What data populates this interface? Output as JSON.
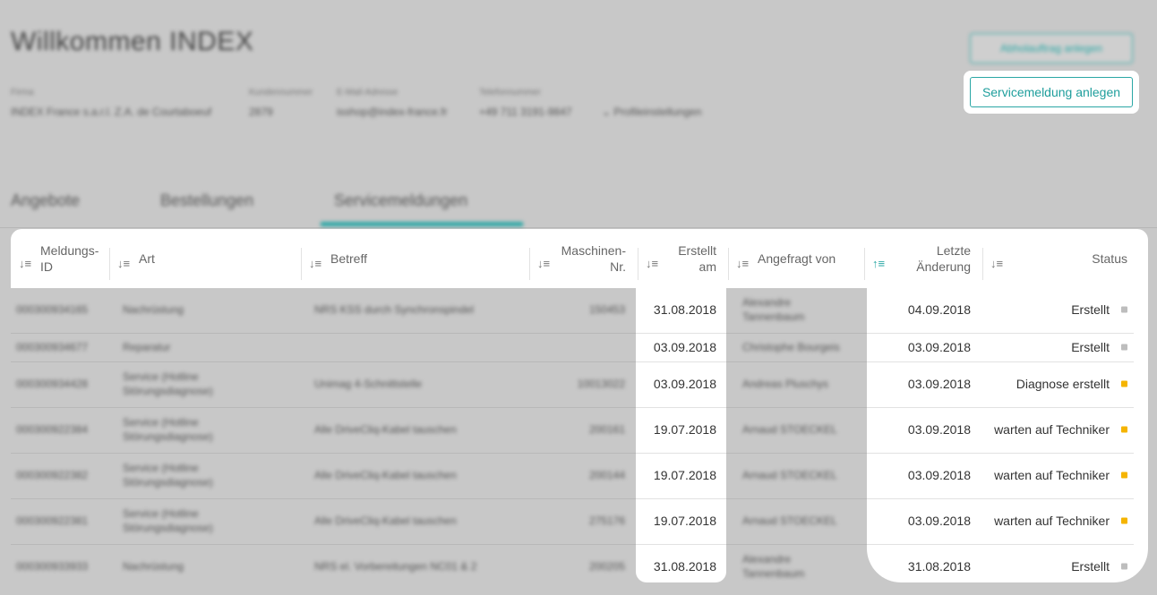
{
  "page": {
    "title": "Willkommen INDEX",
    "info": [
      {
        "label": "Firma",
        "value": "INDEX France s.a.r.l. Z.A. de Courtaboeuf"
      },
      {
        "label": "Kundennummer",
        "value": "2879"
      },
      {
        "label": "E-Mail-Adresse",
        "value": "isshop@index-france.fr"
      },
      {
        "label": "Telefonnummer",
        "value": "+49 711 3191-9847"
      },
      {
        "label": "",
        "value": "Profileinstellungen"
      }
    ],
    "buttons": {
      "abholauftrag": "Abholauftrag anlegen",
      "servicemeldung": "Servicemeldung anlegen"
    },
    "tabs": [
      "Angebote",
      "Bestellungen",
      "Servicemeldungen"
    ],
    "active_tab": 2,
    "accent_color": "#2aa7a5"
  },
  "table": {
    "headers": {
      "id": [
        "Meldungs-",
        "ID"
      ],
      "art": "Art",
      "betreff": "Betreff",
      "maschinen": [
        "Maschinen-",
        "Nr."
      ],
      "erstellt": [
        "Erstellt",
        "am"
      ],
      "angefragt": "Angefragt von",
      "aenderung": [
        "Letzte",
        "Änderung"
      ],
      "status": "Status"
    },
    "rows": [
      {
        "id": "000300934165",
        "art": [
          "Nachrüstung"
        ],
        "betreff": "NRS KSS durch Synchronspindel",
        "maschine": "150453",
        "erstellt": "31.08.2018",
        "angefragt": [
          "Alexandre",
          "Tannenbaum"
        ],
        "aenderung": "04.09.2018",
        "status": "Erstellt",
        "status_color": "#bdbdbd"
      },
      {
        "id": "000300934677",
        "art": [
          "Reparatur"
        ],
        "betreff": "",
        "maschine": "",
        "erstellt": "03.09.2018",
        "angefragt": [
          "Christophe Bourgeis"
        ],
        "aenderung": "03.09.2018",
        "status": "Erstellt",
        "status_color": "#bdbdbd"
      },
      {
        "id": "000300934428",
        "art": [
          "Service (Hotline",
          "Störungsdiagnose)"
        ],
        "betreff": "Unimag 4-Schnittstelle",
        "maschine": "10013022",
        "erstellt": "03.09.2018",
        "angefragt": [
          "Andreas Pluschys"
        ],
        "aenderung": "03.09.2018",
        "status": "Diagnose erstellt",
        "status_color": "#f5b400"
      },
      {
        "id": "000300922384",
        "art": [
          "Service (Hotline",
          "Störungsdiagnose)"
        ],
        "betreff": "Alle DriveCliq-Kabel tauschen",
        "maschine": "200161",
        "erstellt": "19.07.2018",
        "angefragt": [
          "Arnaud STOECKEL"
        ],
        "aenderung": "03.09.2018",
        "status": "warten auf Techniker",
        "status_color": "#f5b400"
      },
      {
        "id": "000300922382",
        "art": [
          "Service (Hotline",
          "Störungsdiagnose)"
        ],
        "betreff": "Alle DriveCliq-Kabel tauschen",
        "maschine": "200144",
        "erstellt": "19.07.2018",
        "angefragt": [
          "Arnaud STOECKEL"
        ],
        "aenderung": "03.09.2018",
        "status": "warten auf Techniker",
        "status_color": "#f5b400"
      },
      {
        "id": "000300922381",
        "art": [
          "Service (Hotline",
          "Störungsdiagnose)"
        ],
        "betreff": "Alle DriveCliq-Kabel tauschen",
        "maschine": "275176",
        "erstellt": "19.07.2018",
        "angefragt": [
          "Arnaud STOECKEL"
        ],
        "aenderung": "03.09.2018",
        "status": "warten auf Techniker",
        "status_color": "#f5b400"
      },
      {
        "id": "000300933933",
        "art": [
          "Nachrüstung"
        ],
        "betreff": "NRS el. Vorbereitungen NC01 & 2",
        "maschine": "200205",
        "erstellt": "31.08.2018",
        "angefragt": [
          "Alexandre",
          "Tannenbaum"
        ],
        "aenderung": "31.08.2018",
        "status": "Erstellt",
        "status_color": "#bdbdbd"
      }
    ]
  }
}
